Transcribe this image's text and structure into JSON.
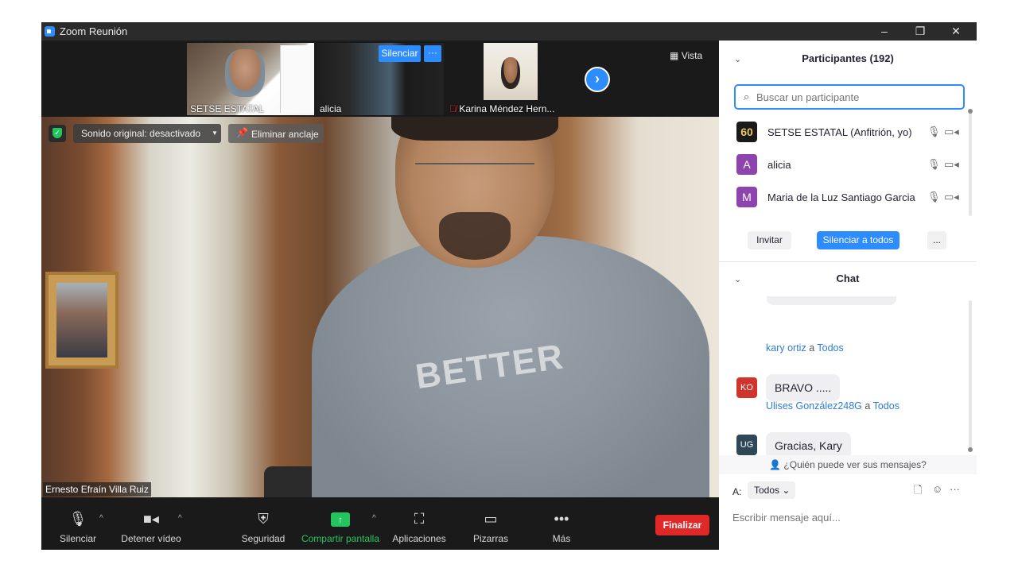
{
  "window": {
    "title": "Zoom Reunión",
    "minimize": "–",
    "restore": "❐",
    "close": "✕"
  },
  "strip": {
    "thumbs": [
      {
        "name": "SETSE ESTATAL"
      },
      {
        "name": "alicia"
      },
      {
        "name": "Karina Méndez Hern..."
      }
    ],
    "mute_label": "Silenciar",
    "more_label": "···",
    "next_icon": "›",
    "vista_label": "Vista"
  },
  "main_video": {
    "sound_label": "Sonido original: desactivado",
    "unpin_label": "Eliminar anclaje",
    "speaker_name": "Ernesto Efraín Villa Ruiz",
    "shirt_text": "BETTER"
  },
  "toolbar": {
    "items": [
      {
        "label": "Silenciar",
        "icon": "microphone-icon"
      },
      {
        "label": "Detener vídeo",
        "icon": "video-camera-icon"
      },
      {
        "label": "Seguridad",
        "icon": "shield-icon"
      },
      {
        "label": "Compartir pantalla",
        "icon": "share-screen-icon"
      },
      {
        "label": "Aplicaciones",
        "icon": "apps-icon"
      },
      {
        "label": "Pizarras",
        "icon": "whiteboard-icon"
      },
      {
        "label": "Más",
        "icon": "more-dots-icon"
      }
    ],
    "end_label": "Finalizar",
    "share_color": "#23c55e",
    "end_color": "#e02828"
  },
  "participants": {
    "title": "Participantes (192)",
    "search_placeholder": "Buscar un participante",
    "list": [
      {
        "name": "SETSE ESTATAL (Anfitrión, yo)",
        "avatar": "60",
        "avatar_color": "#1a1a1a"
      },
      {
        "name": "alicia",
        "avatar": "A",
        "avatar_color": "#8e44ad"
      },
      {
        "name": "Maria de la Luz Santiago Garcia",
        "avatar": "M",
        "avatar_color": "#8e44ad"
      }
    ],
    "invite_label": "Invitar",
    "mute_all_label": "Silenciar a todos",
    "more_label": "..."
  },
  "chat": {
    "title": "Chat",
    "messages": [
      {
        "sender": "kary ortiz",
        "to_word": "a",
        "to": "Todos",
        "text": "BRAVO  .....",
        "avatar": "KO",
        "avatar_color": "#d0352b"
      },
      {
        "sender": "Ulises González248G",
        "to_word": "a",
        "to": "Todos",
        "text": "Gracias, Kary",
        "avatar": "UG",
        "avatar_color": "#2f4858"
      }
    ],
    "who_can_see": "¿Quién puede ver sus mensajes?",
    "to_label": "A:",
    "to_value": "Todos",
    "compose_placeholder": "Escribir mensaje aquí..."
  },
  "colors": {
    "accent": "#2d8cff",
    "panel_bg": "#ffffff",
    "toolbar_bg": "#1a1a1a"
  }
}
